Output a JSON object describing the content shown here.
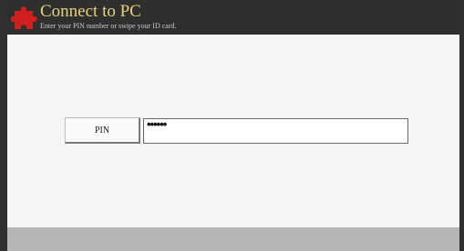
{
  "header": {
    "title": "Connect to PC",
    "subtitle": "Enter your PIN number or swipe your ID card.",
    "logo_icon": "red-puzzle-icon"
  },
  "login": {
    "pin_button_label": "PIN",
    "pin_value": "••••••"
  },
  "colors": {
    "title": "#e8d27a",
    "logo": "#d11f1f",
    "header_bg": "#2f2f2f",
    "content_bg": "#f5f5f5",
    "footer_bg": "#b5b5b5"
  }
}
